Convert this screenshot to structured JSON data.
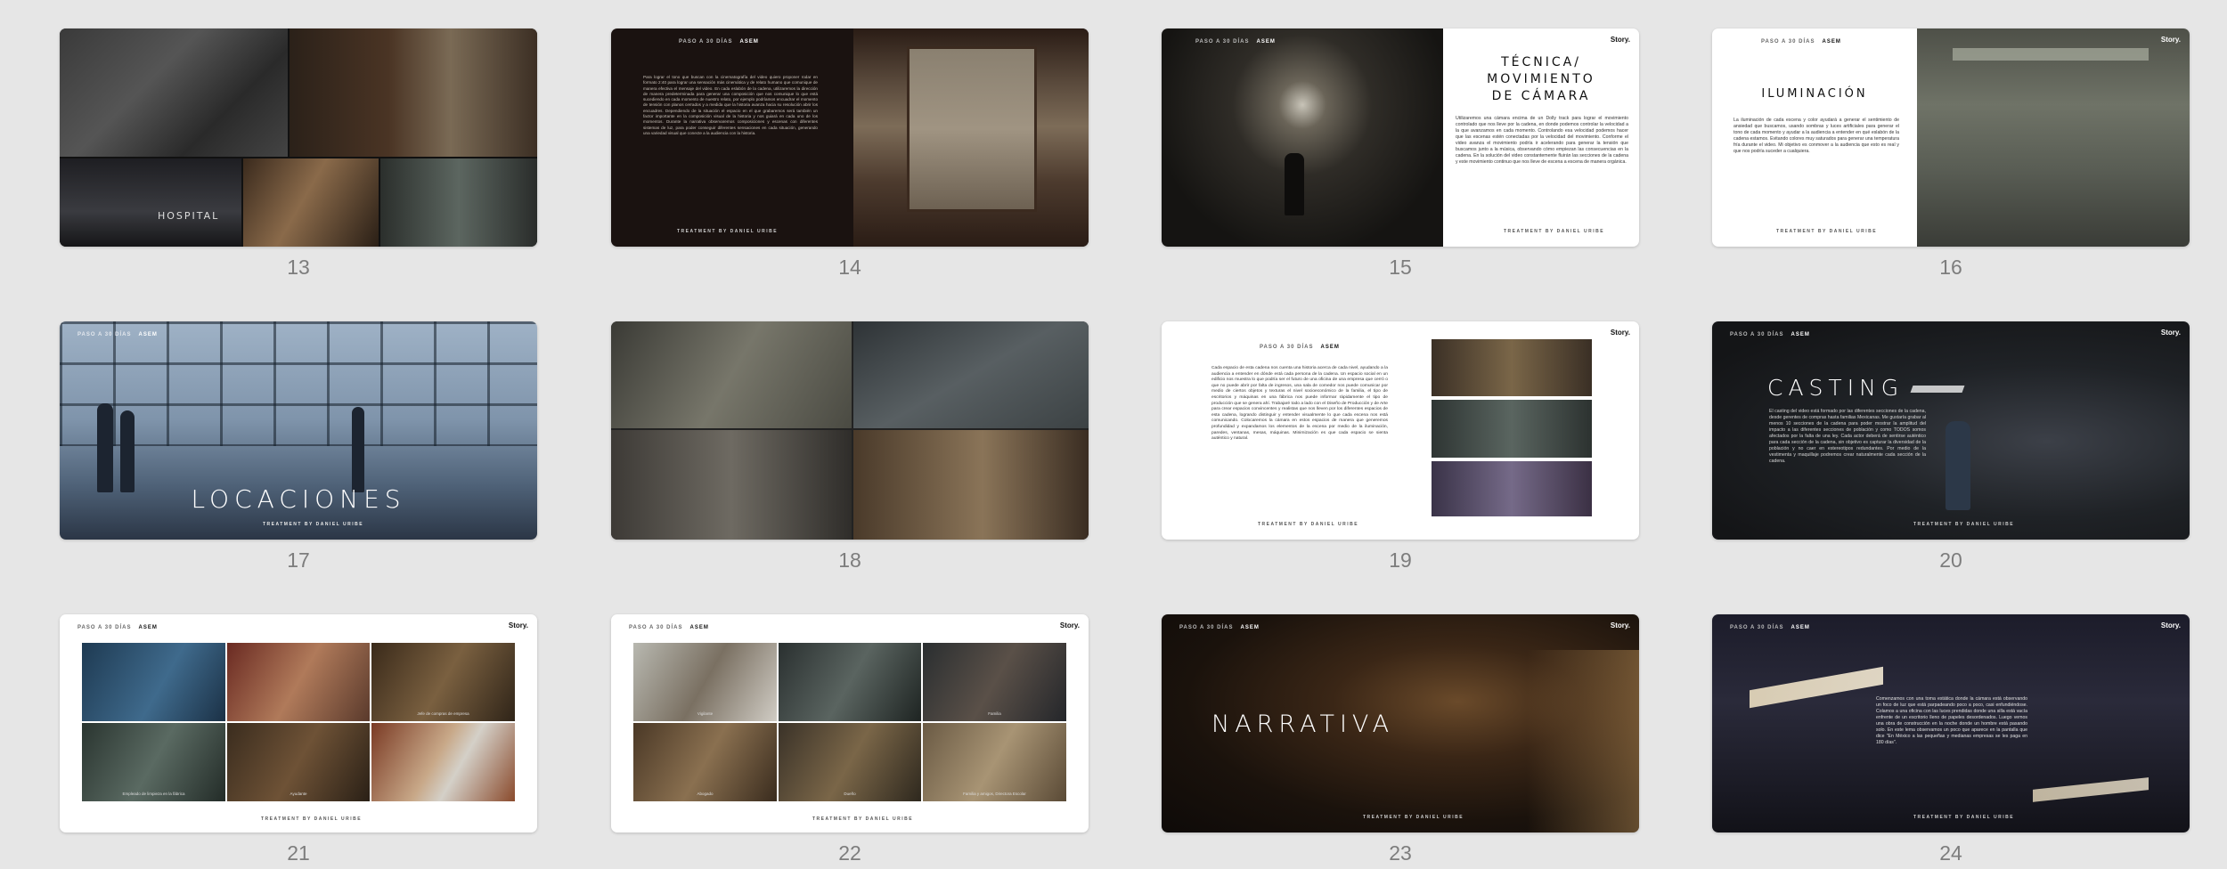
{
  "slide_numbers": [
    "13",
    "14",
    "15",
    "16",
    "17",
    "18",
    "19",
    "20",
    "21",
    "22",
    "23",
    "24"
  ],
  "common": {
    "header": "PASO A 30 DÍAS",
    "brand": "ASEM",
    "logo": "Story.",
    "footer": "TREATMENT  BY  DANIEL URIBE"
  },
  "slide13": {
    "sign_text": "HOSPITAL"
  },
  "slide14": {
    "body": "Para lograr el tono que buscan con la cinematografía del video quiero proponer rodar en formato 2:40 para lograr una sensación más cinemática y de relato humano que comunique de manera efectiva el mensaje del video. En cada eslabón de la cadena, utilizaremos la dirección de manera predeterminada para generar una composición que nos comunique lo que está sucediendo en cada momento de nuestro relato, por ejemplo podríamos encuadrar el momento de tensión con planos cerrados y a medida que la historia avanza hacia su resolución abrir los encuadres. Dependiendo de la situación el espacio en el que grabaremos será también un factor importante en la composición visual de la historia y nos guiará en cada uno de los momentos. Durante la narrativa observaremos composiciones y escenas con diferentes sistemas de luz, para poder conseguir diferentes sensaciones en cada situación, generando una variedad visual que conecte a la audiencia con la historia."
  },
  "slide15": {
    "title_line1": "TÉCNICA/",
    "title_line2": "MOVIMIENTO",
    "title_line3": "DE CÁMARA",
    "body": "Utilizaremos una cámara encima de un Dolly track para lograr el movimiento controlado que nos lleve por la cadena, en donde podemos controlar la velocidad a la que avanzamos en cada momento. Controlando esa velocidad podemos hacer que las escenas estén conectadas por la velocidad del movimiento. Conforme el video avanza el movimiento podría ir acelerando para generar la tensión que buscamos junto a la música, observando cómo empiezan las consecuencias en la cadena. En la solución del video constantemente fluirán las secciones de la cadena y este movimiento continuo que nos lleve de escena a escena de manera orgánica."
  },
  "slide16": {
    "title": "ILUMINACIÓN",
    "body": "La iluminación de cada escena y color ayudará a generar el sentimiento de ansiedad que buscamos, usando sombras y luces artificiales para generar el tono de cada momento y ayudar a la audiencia a entender en qué eslabón de la cadena estamos. Evitando colores muy saturados para generar una temperatura fría durante el video. Mi objetivo es conmover a la audiencia que esto es real y que nos podría suceder a cualquiera."
  },
  "slide17": {
    "title": "LOCACIONES"
  },
  "slide19": {
    "body": "Cada espacio de esta cadena nos cuenta una historia acerca de cada nivel, ayudando a la audiencia a entender en dónde está cada persona de la cadena. Un espacio social en un edificio nos muestra lo que podría ser el futuro de una oficina de una empresa que cerró o que no puede abrir por falta de ingresos, una sala de comedor nos puede comunicar por medio de ciertos objetos y texturas el nivel socioeconómico de la familia, el tipo de escritorios y máquinas en una fábrica nos puede informar rápidamente el tipo de producción que se genera ahí. Trabajaré todo a lado con el Diseño de Producción y de Arte para crear espacios convincentes y realistas que nos lleven por los diferentes espacios de esta cadena, logrando distinguir y entender visualmente lo que cada escena nos está comunicando. Colocaremos la cámara en estos espacios de manera que generemos profundidad y expandamos los elementos de la escena por medio de la iluminación, paredes, ventanas, mesas, máquinas. Minimización es que cada espacio se sienta auténtico y natural."
  },
  "slide20": {
    "title": "CASTING",
    "body": "El casting del video está formado por las diferentes secciones de la cadena, desde gerentes de compras hasta familias Mexicanas. Me gustaría grabar al menos 10 secciones de la cadena para poder mostrar la amplitud del impacto a las diferentes secciones de población y como TODOS somos afectados por la falta de una ley. Cada actor deberá de sentirse auténtico para cada sección de la cadena, sin objetivo es capturar la diversidad de la población y no caer en estereotipos redundantes. Por medio de la vestimenta y maquillaje podremos crear naturalmente cada sección de la cadena."
  },
  "slide21": {
    "captions": [
      "",
      "",
      "Jefe de compras de empresa",
      "Empleado de limpieza en la fábrica",
      "Ayudante",
      ""
    ]
  },
  "slide22": {
    "captions": [
      "Vigilante",
      "",
      "Familia",
      "Abogado",
      "Dueño",
      "Familia y amigos, Directora Escolar"
    ]
  },
  "slide23": {
    "title": "NARRATIVA"
  },
  "slide24": {
    "body": "Comenzamos con una toma estática donde la cámara está observando un foco de luz que está parpadeando poco a poco, casi enfundiéndose. Colamos a una oficina con las luces prendidas donde una silla está vacía enfrente de un escritorio lleno de papeles desordenados. Luego vemos una obra de construcción en la noche donde un hombre está pasando solo. En este lema observamos un poco que aparece en la pantalla que dice \"En México a las pequeñas y medianas empresas se les paga en 180 días\"."
  }
}
